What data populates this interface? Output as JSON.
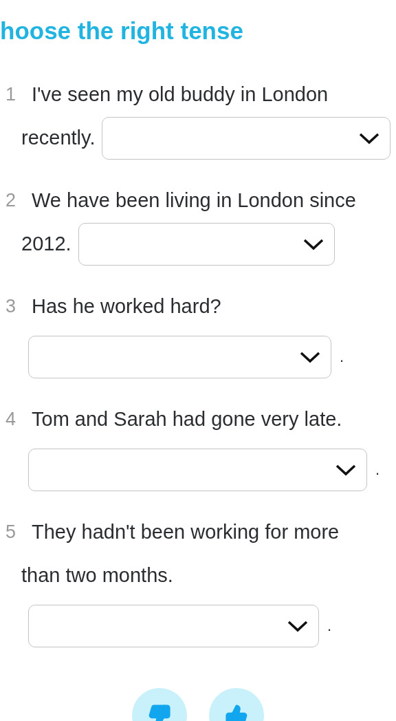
{
  "title": "hoose the right tense",
  "questions": [
    {
      "number": "1",
      "lines": [
        "I've seen my old buddy in London",
        "recently."
      ]
    },
    {
      "number": "2",
      "lines": [
        "We have been living in London since",
        "2012."
      ]
    },
    {
      "number": "3",
      "lines": [
        "Has he worked hard?"
      ],
      "after": "."
    },
    {
      "number": "4",
      "lines": [
        "Tom and Sarah had gone very late."
      ],
      "after": "."
    },
    {
      "number": "5",
      "lines": [
        "They hadn't been working for more",
        "than two months."
      ],
      "after": "."
    }
  ],
  "feedback": [
    {
      "kind": "dislike"
    },
    {
      "kind": "like"
    }
  ]
}
